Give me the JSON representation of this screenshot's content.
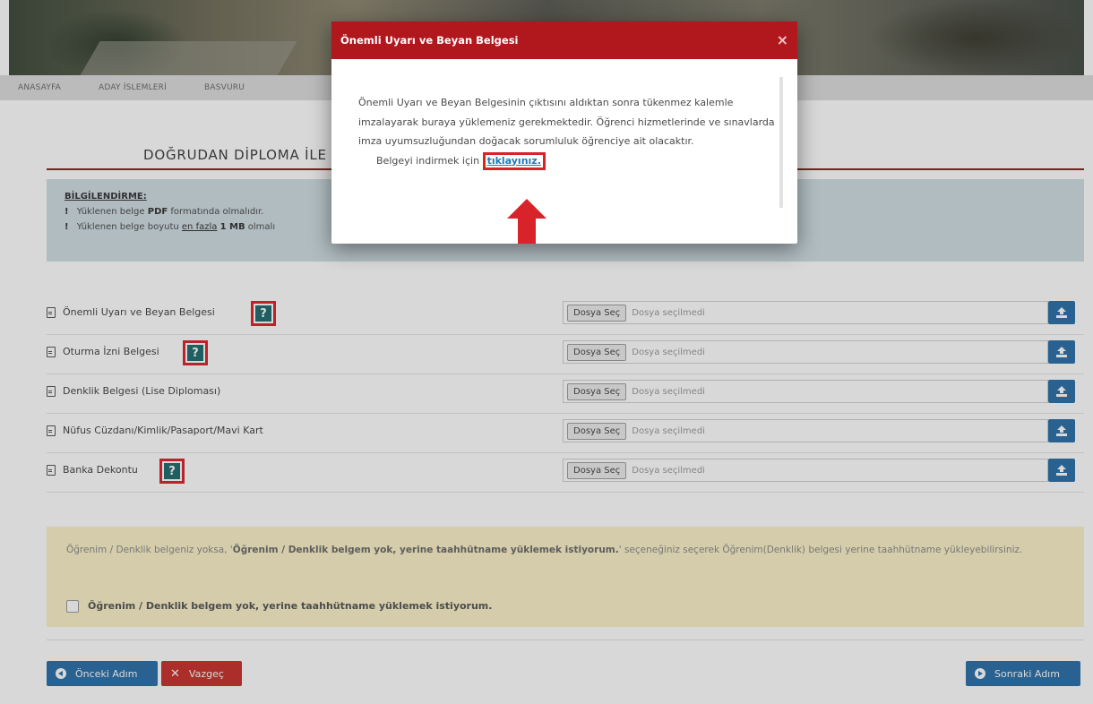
{
  "breadcrumb": [
    "ANASAYFA",
    "ADAY İSLEMLERİ",
    "BASVURU"
  ],
  "page_title": "DOĞRUDAN DİPLOMA İLE",
  "info": {
    "heading": "BİLGİLENDİRME:",
    "line1_prefix": "Yüklenen belge",
    "line1_bold": "PDF",
    "line1_suffix": "formatında olmalıdır.",
    "line2_prefix": "Yüklenen belge boyutu",
    "line2_underline": "en fazla",
    "line2_bold": "1 MB",
    "line2_suffix": "olmalı"
  },
  "documents": [
    {
      "label": "Önemli Uyarı ve Beyan Belgesi",
      "has_help": true
    },
    {
      "label": "Oturma İzni Belgesi",
      "has_help": true
    },
    {
      "label": "Denklik Belgesi (Lise Diploması)",
      "has_help": false
    },
    {
      "label": "Nüfus Cüzdanı/Kimlik/Pasaport/Mavi Kart",
      "has_help": false
    },
    {
      "label": "Banka Dekontu",
      "has_help": true
    }
  ],
  "help_label": "?",
  "file_button_label": "Dosya Seç",
  "file_placeholder": "Dosya seçilmedi",
  "warning": {
    "text_prefix": "Öğrenim / Denklik belgeniz yoksa, '",
    "text_bold": "Öğrenim / Denklik belgem yok, yerine taahhütname yüklemek istiyorum.",
    "text_suffix": "' seçeneğiniz seçerek Öğrenim(Denklik) belgesi yerine taahhütname yükleyebilirsiniz.",
    "checkbox_label": "Öğrenim / Denklik belgem yok, yerine taahhütname yüklemek istiyorum."
  },
  "buttons": {
    "prev": "Önceki Adım",
    "cancel": "Vazgeç",
    "next": "Sonraki Adım"
  },
  "modal": {
    "title": "Önemli Uyarı ve Beyan Belgesi",
    "close": "×",
    "body": "Önemli Uyarı ve Beyan Belgesinin çıktısını aldıktan sonra tükenmez kalemle imzalayarak buraya yüklemeniz gerekmektedir. Öğrenci hizmetlerinde ve sınavlarda imza uyumsuzluğundan doğacak sorumluluk öğrenciye ait olacaktır.",
    "link_prefix": "Belgeyi indirmek için",
    "link_text": "tıklayınız."
  },
  "colors": {
    "modal_header": "#b0181e",
    "highlight_red": "#d9232a",
    "help_teal": "#1f6c6e",
    "primary_blue": "#2a6fa8",
    "danger_red": "#c9302c"
  }
}
